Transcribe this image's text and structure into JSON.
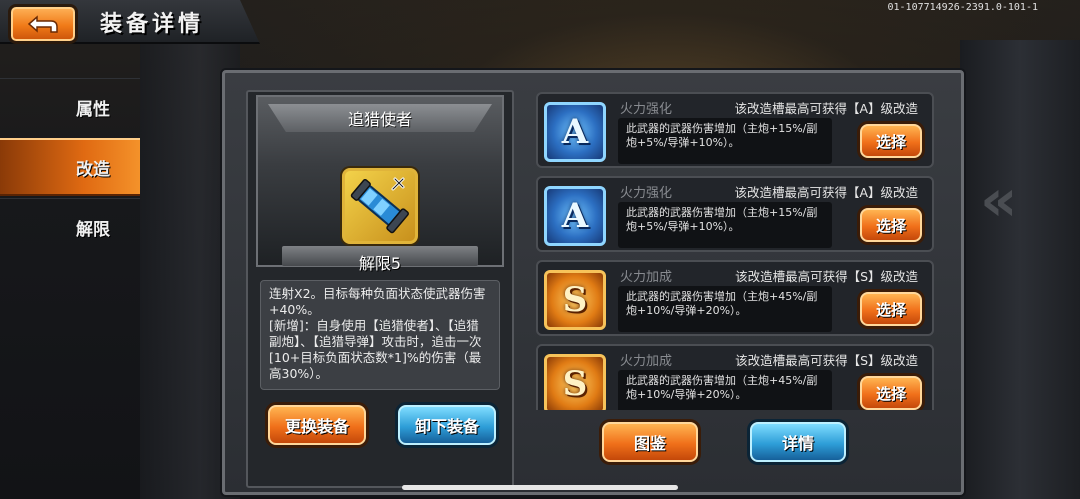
{
  "header": {
    "title": "装备详情",
    "build_id": "01-107714926-2391.0-101-1"
  },
  "sidebar": {
    "items": [
      {
        "label": "属性",
        "active": false
      },
      {
        "label": "改造",
        "active": true
      },
      {
        "label": "解限",
        "active": false
      }
    ]
  },
  "equipment": {
    "name": "追猎使者",
    "limit_level": "解限5",
    "icon": "homing-launcher-icon",
    "description": [
      "连射X2。目标每种负面状态使武器伤害+40%。",
      "[新增]：自身使用【追猎使者】、【追猎副炮】、【追猎导弹】攻击时，追击一次[10+目标负面状态数*1]%的伤害（最高30%）。"
    ],
    "change_button": "更换装备",
    "unequip_button": "卸下装备"
  },
  "slots": [
    {
      "grade": "A",
      "type": "火力强化",
      "note": "该改造槽最高可获得【A】级改造",
      "desc": "此武器的武器伤害增加（主炮+15%/副炮+5%/导弹+10%）。",
      "button": "选择"
    },
    {
      "grade": "A",
      "type": "火力强化",
      "note": "该改造槽最高可获得【A】级改造",
      "desc": "此武器的武器伤害增加（主炮+15%/副炮+5%/导弹+10%）。",
      "button": "选择"
    },
    {
      "grade": "S",
      "type": "火力加成",
      "note": "该改造槽最高可获得【S】级改造",
      "desc": "此武器的武器伤害增加（主炮+45%/副炮+10%/导弹+20%）。",
      "button": "选择"
    },
    {
      "grade": "S",
      "type": "火力加成",
      "note": "该改造槽最高可获得【S】级改造",
      "desc": "此武器的武器伤害增加（主炮+45%/副炮+10%/导弹+20%）。",
      "button": "选择"
    }
  ],
  "bottom": {
    "codex_button": "图鉴",
    "details_button": "详情"
  },
  "colors": {
    "accent_orange": "#f0701a",
    "accent_blue": "#2e9ed8",
    "grade_a": "#2c6fc2",
    "grade_s": "#e07b14"
  }
}
